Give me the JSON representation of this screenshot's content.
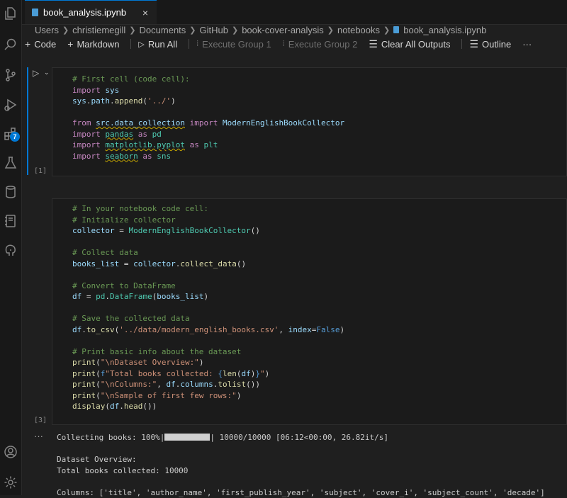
{
  "activity_bar": {
    "extensions_badge": "7"
  },
  "tab": {
    "label": "book_analysis.ipynb",
    "close": "×"
  },
  "breadcrumb": [
    "Users",
    "christiemegill",
    "Documents",
    "GitHub",
    "book-cover-analysis",
    "notebooks",
    "book_analysis.ipynb"
  ],
  "toolbar": {
    "code": "Code",
    "markdown": "Markdown",
    "run_all": "Run All",
    "execute_group_1": "Execute Group 1",
    "execute_group_2": "Execute Group 2",
    "clear_all_outputs": "Clear All Outputs",
    "outline": "Outline",
    "more": "···"
  },
  "cells": [
    {
      "execution_count": "[1]",
      "lines": [
        [
          [
            "cm",
            "# First cell (code cell):"
          ]
        ],
        [
          [
            "kw",
            "import"
          ],
          [
            "",
            " "
          ],
          [
            "var",
            "sys"
          ]
        ],
        [
          [
            "var",
            "sys"
          ],
          [
            "",
            "."
          ],
          [
            "var",
            "path"
          ],
          [
            "",
            "."
          ],
          [
            "fn",
            "append"
          ],
          [
            "",
            "("
          ],
          [
            "str",
            "'../'"
          ],
          [
            "",
            ")"
          ]
        ],
        [],
        [
          [
            "kw",
            "from"
          ],
          [
            "",
            " "
          ],
          [
            "var sq",
            "src.data_collection"
          ],
          [
            "",
            " "
          ],
          [
            "kw",
            "import"
          ],
          [
            "",
            " "
          ],
          [
            "var",
            "ModernEnglishBookCollector"
          ]
        ],
        [
          [
            "kw",
            "import"
          ],
          [
            "",
            " "
          ],
          [
            "cls sq",
            "pandas"
          ],
          [
            "",
            " "
          ],
          [
            "kw",
            "as"
          ],
          [
            "",
            " "
          ],
          [
            "cls",
            "pd"
          ]
        ],
        [
          [
            "kw",
            "import"
          ],
          [
            "",
            " "
          ],
          [
            "cls sq",
            "matplotlib.pyplot"
          ],
          [
            "",
            " "
          ],
          [
            "kw",
            "as"
          ],
          [
            "",
            " "
          ],
          [
            "cls",
            "plt"
          ]
        ],
        [
          [
            "kw",
            "import"
          ],
          [
            "",
            " "
          ],
          [
            "cls sq",
            "seaborn"
          ],
          [
            "",
            " "
          ],
          [
            "kw",
            "as"
          ],
          [
            "",
            " "
          ],
          [
            "cls",
            "sns"
          ]
        ]
      ]
    },
    {
      "execution_count": "[3]",
      "lines": [
        [
          [
            "cm",
            "# In your notebook code cell:"
          ]
        ],
        [
          [
            "cm",
            "# Initialize collector"
          ]
        ],
        [
          [
            "var",
            "collector"
          ],
          [
            "",
            " = "
          ],
          [
            "cls",
            "ModernEnglishBookCollector"
          ],
          [
            "",
            "()"
          ]
        ],
        [],
        [
          [
            "cm",
            "# Collect data"
          ]
        ],
        [
          [
            "var",
            "books_list"
          ],
          [
            "",
            " = "
          ],
          [
            "var",
            "collector"
          ],
          [
            "",
            "."
          ],
          [
            "fn",
            "collect_data"
          ],
          [
            "",
            "()"
          ]
        ],
        [],
        [
          [
            "cm",
            "# Convert to DataFrame"
          ]
        ],
        [
          [
            "var",
            "df"
          ],
          [
            "",
            " = "
          ],
          [
            "cls",
            "pd"
          ],
          [
            "",
            "."
          ],
          [
            "cls",
            "DataFrame"
          ],
          [
            "",
            "("
          ],
          [
            "var",
            "books_list"
          ],
          [
            "",
            ")"
          ]
        ],
        [],
        [
          [
            "cm",
            "# Save the collected data"
          ]
        ],
        [
          [
            "var",
            "df"
          ],
          [
            "",
            "."
          ],
          [
            "fn",
            "to_csv"
          ],
          [
            "",
            "("
          ],
          [
            "str",
            "'../data/modern_english_books.csv'"
          ],
          [
            "",
            ", "
          ],
          [
            "var",
            "index"
          ],
          [
            "",
            "="
          ],
          [
            "bool",
            "False"
          ],
          [
            "",
            ")"
          ]
        ],
        [],
        [
          [
            "cm",
            "# Print basic info about the dataset"
          ]
        ],
        [
          [
            "fn",
            "print"
          ],
          [
            "",
            "("
          ],
          [
            "str",
            "\"\\nDataset Overview:\""
          ],
          [
            "",
            ")"
          ]
        ],
        [
          [
            "fn",
            "print"
          ],
          [
            "",
            "("
          ],
          [
            "bool",
            "f"
          ],
          [
            "str",
            "\"Total books collected: "
          ],
          [
            "bool",
            "{"
          ],
          [
            "fn",
            "len"
          ],
          [
            "",
            "("
          ],
          [
            "var",
            "df"
          ],
          [
            "",
            ")"
          ],
          [
            "bool",
            "}"
          ],
          [
            "str",
            "\""
          ],
          [
            "",
            ")"
          ]
        ],
        [
          [
            "fn",
            "print"
          ],
          [
            "",
            "("
          ],
          [
            "str",
            "\"\\nColumns:\""
          ],
          [
            "",
            ", "
          ],
          [
            "var",
            "df"
          ],
          [
            "",
            "."
          ],
          [
            "var",
            "columns"
          ],
          [
            "",
            "."
          ],
          [
            "fn",
            "tolist"
          ],
          [
            "",
            "())"
          ]
        ],
        [
          [
            "fn",
            "print"
          ],
          [
            "",
            "("
          ],
          [
            "str",
            "\"\\nSample of first few rows:\""
          ],
          [
            "",
            ")"
          ]
        ],
        [
          [
            "fn",
            "display"
          ],
          [
            "",
            "("
          ],
          [
            "var",
            "df"
          ],
          [
            "",
            "."
          ],
          [
            "fn",
            "head"
          ],
          [
            "",
            "())"
          ]
        ]
      ]
    }
  ],
  "output": {
    "more": "···",
    "progress_prefix": "Collecting books: 100%|",
    "progress_suffix": "| 10000/10000 [06:12<00:00, 26.82it/s]",
    "progress_value": 1.0,
    "line_overview": "Dataset Overview:",
    "line_total": "Total books collected: 10000",
    "line_columns": "Columns: ['title', 'author_name', 'first_publish_year', 'subject', 'cover_i', 'subject_count', 'decade']"
  }
}
